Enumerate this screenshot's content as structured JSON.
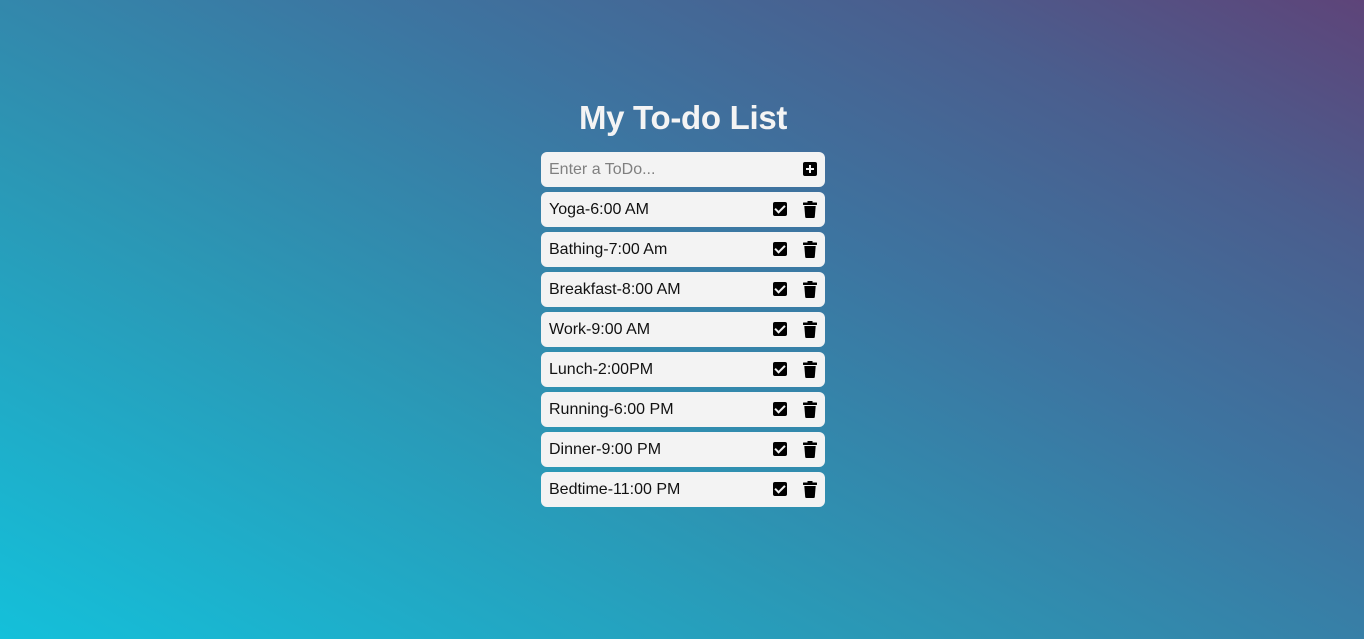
{
  "header": {
    "title": "My To-do List"
  },
  "input": {
    "placeholder": "Enter a ToDo...",
    "value": "",
    "add_icon": "plus-square-icon"
  },
  "todos": [
    {
      "text": "Yoga-6:00 AM",
      "check_icon": "check-square-icon",
      "delete_icon": "trash-icon"
    },
    {
      "text": "Bathing-7:00 Am",
      "check_icon": "check-square-icon",
      "delete_icon": "trash-icon"
    },
    {
      "text": "Breakfast-8:00 AM",
      "check_icon": "check-square-icon",
      "delete_icon": "trash-icon"
    },
    {
      "text": "Work-9:00 AM",
      "check_icon": "check-square-icon",
      "delete_icon": "trash-icon"
    },
    {
      "text": "Lunch-2:00PM",
      "check_icon": "check-square-icon",
      "delete_icon": "trash-icon"
    },
    {
      "text": "Running-6:00 PM",
      "check_icon": "check-square-icon",
      "delete_icon": "trash-icon"
    },
    {
      "text": "Dinner-9:00 PM",
      "check_icon": "check-square-icon",
      "delete_icon": "trash-icon"
    },
    {
      "text": "Bedtime-11:00 PM",
      "check_icon": "check-square-icon",
      "delete_icon": "trash-icon"
    }
  ],
  "colors": {
    "background_gradient": [
      "#14c0da",
      "#2b97b5",
      "#3d74a0",
      "#5e4479"
    ],
    "card": "#f3f3f3",
    "title": "#f4f4f4",
    "icon": "#000000"
  }
}
